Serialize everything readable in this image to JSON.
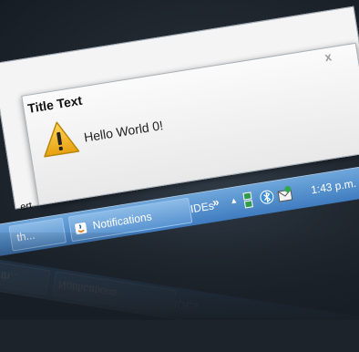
{
  "popup": {
    "title": "Title Text",
    "message": "Hello World 0!",
    "close_label": "x",
    "icon": "warning-icon"
  },
  "background_window": {
    "stub_text": "ert"
  },
  "taskbar": {
    "app_button_label": "th...",
    "notifications_button_label": "Notifications",
    "tray_label": "IDEs",
    "tray_chevron": "»",
    "tray_caret": "▲",
    "tray_icons": [
      "network-icon",
      "bluetooth-icon",
      "mail-icon"
    ],
    "clock": "1:43 p.m."
  },
  "colors": {
    "taskbar_top": "#6fa7db",
    "taskbar_bottom": "#3f7cc0",
    "warning": "#f3b61e",
    "background": "#1c232b"
  }
}
